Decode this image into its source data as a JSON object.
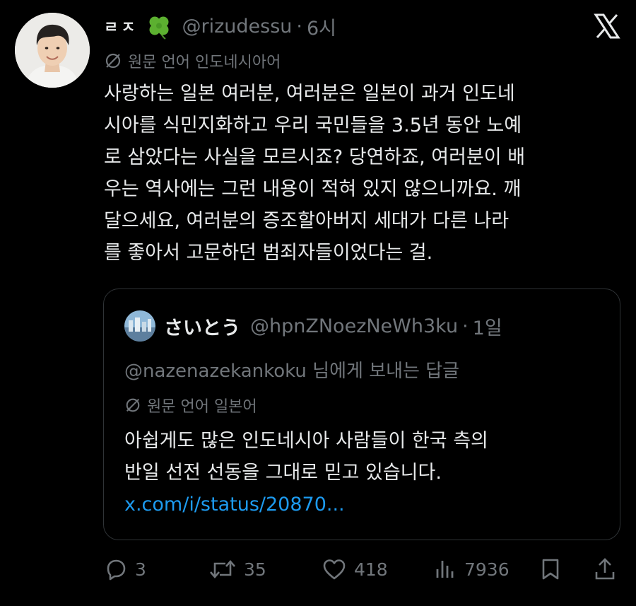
{
  "tweet": {
    "display_name": "ㄹㅈ",
    "handle": "@rizudessu",
    "separator": "·",
    "time": "6시",
    "translated_label": "원문 언어 인도네시아어",
    "body_lines": [
      "사랑하는 일본 여러분, 여러분은 일본이 과거 인도네",
      "시아를 식민지화하고 우리 국민들을 3.5년 동안 노예",
      "로 삼았다는 사실을 모르시죠? 당연하죠, 여러분이 배",
      "우는 역사에는 그런 내용이 적혀 있지 않으니까요. 깨",
      "달으세요, 여러분의 증조할아버지 세대가 다른 나라",
      "를 좋아서 고문하던 범죄자들이었다는 걸."
    ]
  },
  "quote": {
    "display_name": "さいとう",
    "handle": "@hpnZNoezNeWh3ku",
    "separator": "·",
    "time": "1일",
    "reply_mention": "@nazenazekankoku",
    "reply_suffix": " 님에게 보내는 답글",
    "translated_label": "원문 언어 일본어",
    "body_lines": [
      "아쉽게도 많은 인도네시아 사람들이 한국 측의",
      "반일 선전 선동을 그대로 믿고 있습니다."
    ],
    "link": "x.com/i/status/20870..."
  },
  "actions": {
    "replies": "3",
    "retweets": "35",
    "likes": "418",
    "views": "7936"
  },
  "colors": {
    "background": "#000000",
    "text": "#e7e9ea",
    "muted": "#71767b",
    "link": "#1d9bf0",
    "border": "#2f3336"
  }
}
